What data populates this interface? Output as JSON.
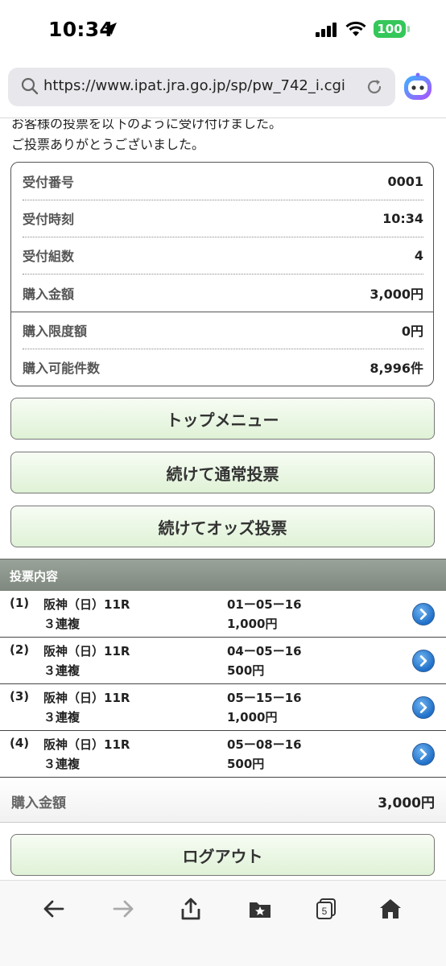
{
  "status_bar": {
    "time": "10:34",
    "battery": "100"
  },
  "browser": {
    "url": "https://www.ipat.jra.go.jp/sp/pw_742_i.cgi",
    "tabs_count": "5"
  },
  "messages": {
    "line1": "お客様の投票を以下のように受け付けました。",
    "line2": "ご投票ありがとうございました。"
  },
  "summary": {
    "rows": [
      {
        "label": "受付番号",
        "value": "0001"
      },
      {
        "label": "受付時刻",
        "value": "10:34"
      },
      {
        "label": "受付組数",
        "value": "4"
      },
      {
        "label": "購入金額",
        "value": "3,000円"
      },
      {
        "label": "購入限度額",
        "value": "0円"
      },
      {
        "label": "購入可能件数",
        "value": "8,996件"
      }
    ]
  },
  "buttons": {
    "top_menu": "トップメニュー",
    "continue_normal": "続けて通常投票",
    "continue_odds": "続けてオッズ投票",
    "logout": "ログアウト"
  },
  "bets": {
    "header": "投票内容",
    "items": [
      {
        "no": "(1)",
        "race": "阪神（日）11R",
        "type": "３連複",
        "combo": "01ー05ー16",
        "amount": "1,000円"
      },
      {
        "no": "(2)",
        "race": "阪神（日）11R",
        "type": "３連複",
        "combo": "04ー05ー16",
        "amount": "500円"
      },
      {
        "no": "(3)",
        "race": "阪神（日）11R",
        "type": "３連複",
        "combo": "05ー15ー16",
        "amount": "1,000円"
      },
      {
        "no": "(4)",
        "race": "阪神（日）11R",
        "type": "３連複",
        "combo": "05ー08ー16",
        "amount": "500円"
      }
    ],
    "total_label": "購入金額",
    "total_value": "3,000円"
  },
  "colors": {
    "button_green": "#dff2d6",
    "section_header": "#8a938a",
    "battery": "#34c759",
    "arrow_blue": "#1f6fc8"
  }
}
